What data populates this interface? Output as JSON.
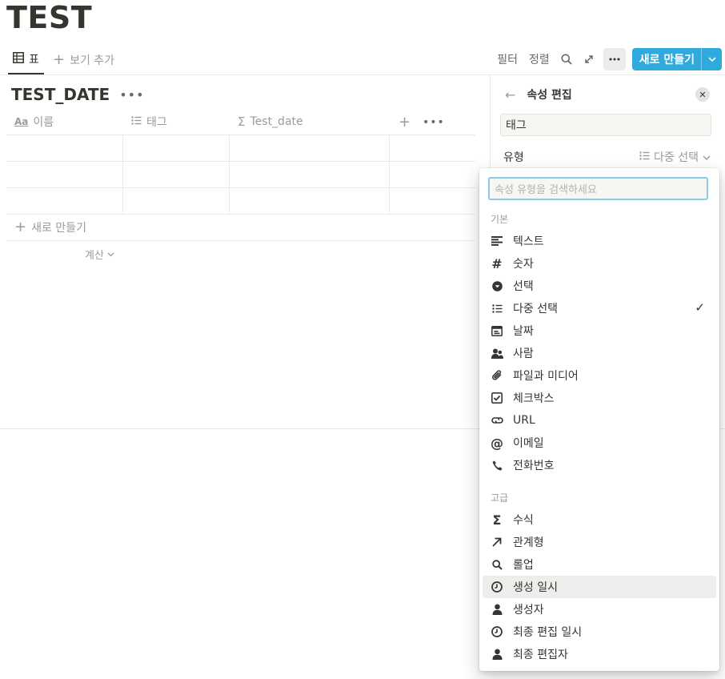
{
  "page": {
    "title": "TEST"
  },
  "topbar": {
    "view_tab": "표",
    "add_view": "보기 추가",
    "filter": "필터",
    "sort": "정렬",
    "new_button": "새로 만들기"
  },
  "database": {
    "title": "TEST_DATE",
    "columns": [
      {
        "label": "이름",
        "icon": "title-aa-icon"
      },
      {
        "label": "태그",
        "icon": "multi-select-icon"
      },
      {
        "label": "Test_date",
        "icon": "formula-sigma-icon"
      }
    ],
    "row_count": 3,
    "new_row": "새로 만들기",
    "calculate": "계산"
  },
  "side_panel": {
    "title": "속성 편집",
    "property_name": "태그",
    "type_label": "유형",
    "type_value": "다중 선택"
  },
  "type_menu": {
    "search_placeholder": "속성 유형을 검색하세요",
    "basic_label": "기본",
    "advanced_label": "고급",
    "basic_items": [
      {
        "label": "텍스트",
        "icon": "text-icon"
      },
      {
        "label": "숫자",
        "icon": "number-icon"
      },
      {
        "label": "선택",
        "icon": "select-icon"
      },
      {
        "label": "다중 선택",
        "icon": "multi-select-icon",
        "checked": true
      },
      {
        "label": "날짜",
        "icon": "calendar-icon"
      },
      {
        "label": "사람",
        "icon": "people-icon"
      },
      {
        "label": "파일과 미디어",
        "icon": "paperclip-icon"
      },
      {
        "label": "체크박스",
        "icon": "checkbox-icon"
      },
      {
        "label": "URL",
        "icon": "link-icon"
      },
      {
        "label": "이메일",
        "icon": "at-icon"
      },
      {
        "label": "전화번호",
        "icon": "phone-icon"
      }
    ],
    "advanced_items": [
      {
        "label": "수식",
        "icon": "formula-sigma-icon"
      },
      {
        "label": "관계형",
        "icon": "relation-arrow-icon"
      },
      {
        "label": "롤업",
        "icon": "rollup-search-icon"
      },
      {
        "label": "생성 일시",
        "icon": "clock-icon",
        "hovered": true
      },
      {
        "label": "생성자",
        "icon": "person-icon"
      },
      {
        "label": "최종 편집 일시",
        "icon": "clock-icon"
      },
      {
        "label": "최종 편집자",
        "icon": "person-icon"
      }
    ]
  }
}
